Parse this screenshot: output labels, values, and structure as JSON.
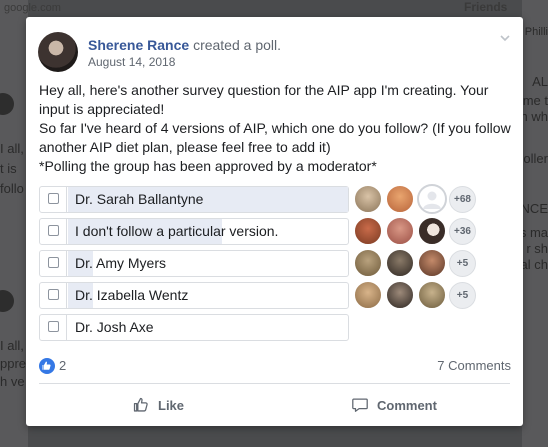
{
  "background": {
    "top_left": "google.com",
    "top_right": "Friends",
    "top_right_2": "Philli",
    "left_fragments": [
      "I all,",
      "t is",
      "follo",
      "I all,",
      "ppre",
      "h ve"
    ],
    "right_fragments": [
      "AL",
      "me t",
      "h wh",
      "oller",
      "NCE",
      "s ma",
      "r sh",
      "al ch"
    ]
  },
  "post": {
    "author": "Sherene Rance",
    "action": "created a poll.",
    "date": "August 14, 2018",
    "text_lines": [
      "Hey all, here's another survey question for the AIP app I'm creating. Your input is appreciated!",
      "So far I've heard of 4 versions of AIP, which one do you follow? (If you follow another AIP diet plan, please feel free to add it)",
      "*Polling the group has been approved by a moderator*"
    ]
  },
  "poll": {
    "options": [
      {
        "label": "Dr. Sarah Ballantyne",
        "more": "+68",
        "fill_fraction": 1.0
      },
      {
        "label": "I don't follow a particular version.",
        "more": "+36",
        "fill_fraction": 0.55
      },
      {
        "label": "Dr. Amy Myers",
        "more": "+5",
        "fill_fraction": 0.09
      },
      {
        "label": "Dr. Izabella Wentz",
        "more": "+5",
        "fill_fraction": 0.09
      },
      {
        "label": "Dr. Josh Axe",
        "more": "",
        "fill_fraction": 0
      }
    ]
  },
  "footer": {
    "like_count": "2",
    "comments": "7 Comments",
    "like_label": "Like",
    "comment_label": "Comment"
  },
  "colors": {
    "accent": "#385898",
    "like_blue": "#3578e5",
    "poll_fill": "#e7ebf4"
  },
  "icons": [
    "chevron-down-icon",
    "like-reaction-icon",
    "thumbs-up-icon",
    "comment-icon"
  ]
}
